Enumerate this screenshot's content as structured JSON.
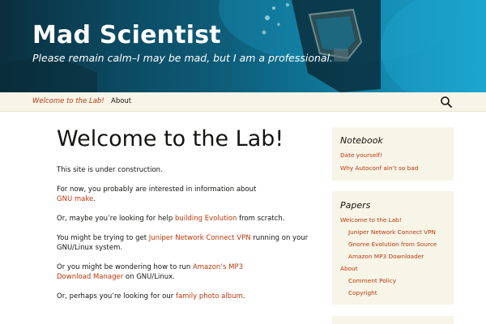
{
  "header": {
    "title": "Mad Scientist",
    "tagline": "Please remain calm–I may be mad, but I am a professional."
  },
  "nav": {
    "items": [
      "Welcome to the Lab!",
      "About"
    ],
    "active": "Welcome to the Lab!",
    "search_icon": "search-icon"
  },
  "main": {
    "title": "Welcome to the Lab!",
    "p1": "This site is under construction.",
    "p2": {
      "text": "For now, you probably are interested in information about",
      "link": "GNU make",
      "end": "."
    },
    "p3": {
      "pre": "Or, maybe you’re looking for help ",
      "link": "building Evolution",
      "post": " from scratch."
    },
    "p4": {
      "pre": "You might be trying to get ",
      "link": "Juniper Network Connect VPN",
      "post": " running on your",
      "line2": "GNU/Linux system."
    },
    "p5": {
      "pre": "Or you might be wondering how to run ",
      "link1": "Amazon’s MP3",
      "link2": "Download Manager",
      "post": " on GNU/Linux."
    },
    "p6": {
      "pre": "Or, perhaps you’re looking for our ",
      "link": "family photo album",
      "end": "."
    }
  },
  "sidebar": {
    "notebook": {
      "title": "Notebook",
      "links": [
        "Date yourself!",
        "Why Autoconf ain’t so bad"
      ]
    },
    "papers": {
      "title": "Papers",
      "links": [
        "Welcome to the Lab!",
        "Juniper Network Connect VPN",
        "Gnome Evolution from Source",
        "Amazon MP3 Downloader",
        "About",
        "Comment Policy",
        "Copyright"
      ]
    }
  },
  "colors": {
    "link": "#bc360a",
    "sidebar_bg": "#f7f5e7",
    "header_bg": "#0e5c78"
  }
}
